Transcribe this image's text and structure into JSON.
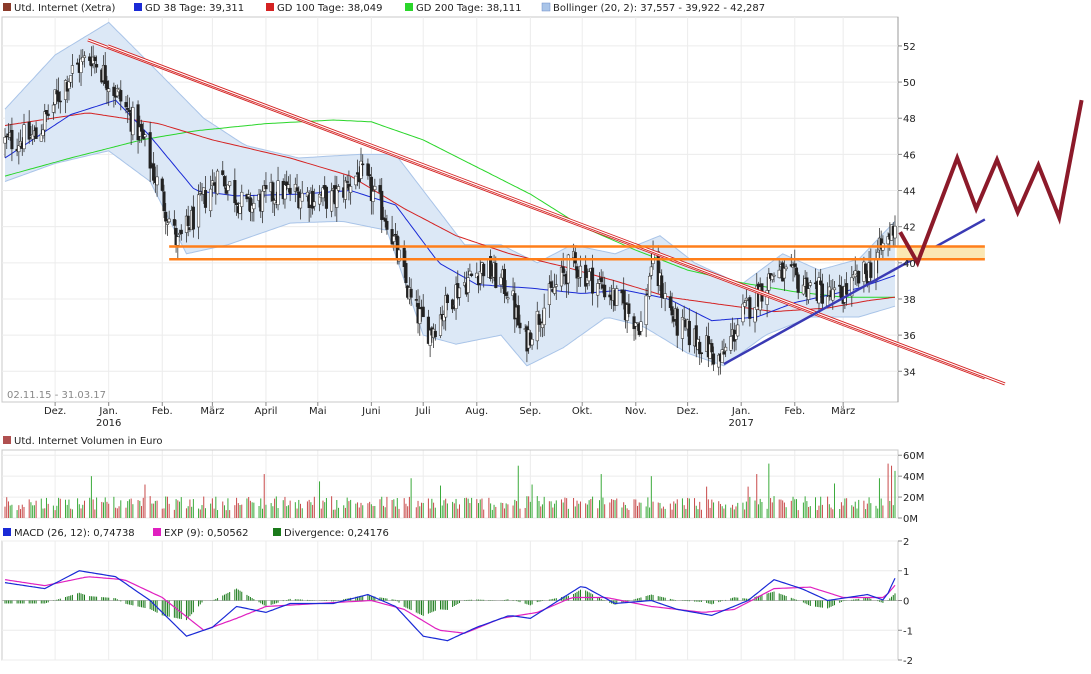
{
  "price_panel": {
    "legend": [
      {
        "label": "Utd. Internet (Xetra)",
        "color": "#8a3a2a"
      },
      {
        "label": "GD 38 Tage: 39,311",
        "color": "#1a2ad6"
      },
      {
        "label": "GD 100 Tage: 38,049",
        "color": "#d42222"
      },
      {
        "label": "GD 200 Tage: 38,111",
        "color": "#2ad62a"
      },
      {
        "label": "Bollinger (20, 2): 37,557 - 39,922 - 42,287",
        "color": "#a9c4e8"
      }
    ],
    "date_range": "02.11.15 - 31.03.17"
  },
  "volume_panel": {
    "legend": [
      {
        "label": "Utd. Internet Volumen in Euro",
        "color": "#b05050"
      }
    ]
  },
  "macd_panel": {
    "legend": [
      {
        "label": "MACD (26, 12): 0,74738",
        "color": "#1a2ad6"
      },
      {
        "label": "EXP (9): 0,50562",
        "color": "#e020c0"
      },
      {
        "label": "Divergence: 0,24176",
        "color": "#1a7a1a"
      }
    ]
  },
  "chart_data": [
    {
      "type": "candlestick",
      "x_tick_labels": [
        "Dez.",
        "Jan.",
        "Feb.",
        "März",
        "April",
        "Mai",
        "Juni",
        "Juli",
        "Aug.",
        "Sep.",
        "Okt.",
        "Nov.",
        "Dez.",
        "Jan.",
        "Feb.",
        "März"
      ],
      "x_year_labels": [
        {
          "label": "2016",
          "under": "Jan."
        },
        {
          "label": "2017",
          "under": "Jan."
        }
      ],
      "y_tick_labels": [
        "52",
        "50",
        "48",
        "46",
        "44",
        "42",
        "40",
        "38",
        "36",
        "34"
      ],
      "ylim": [
        32.3,
        53.6
      ],
      "close_keypoints": [
        [
          "2015-11-02",
          46.7
        ],
        [
          "2015-11-20",
          47.0
        ],
        [
          "2015-12-10",
          50.5
        ],
        [
          "2015-12-22",
          51.5
        ],
        [
          "2016-01-05",
          49.5
        ],
        [
          "2016-01-20",
          47.0
        ],
        [
          "2016-02-10",
          41.0
        ],
        [
          "2016-02-25",
          43.5
        ],
        [
          "2016-03-05",
          45.0
        ],
        [
          "2016-03-20",
          43.0
        ],
        [
          "2016-04-10",
          44.0
        ],
        [
          "2016-05-10",
          43.5
        ],
        [
          "2016-05-25",
          45.0
        ],
        [
          "2016-06-10",
          42.5
        ],
        [
          "2016-06-25",
          37.5
        ],
        [
          "2016-07-05",
          36.2
        ],
        [
          "2016-07-20",
          38.5
        ],
        [
          "2016-08-05",
          39.8
        ],
        [
          "2016-08-20",
          38.5
        ],
        [
          "2016-08-28",
          35.5
        ],
        [
          "2016-09-10",
          37.8
        ],
        [
          "2016-09-25",
          40.0
        ],
        [
          "2016-10-15",
          38.5
        ],
        [
          "2016-11-05",
          36.5
        ],
        [
          "2016-11-10",
          40.0
        ],
        [
          "2016-11-25",
          36.5
        ],
        [
          "2016-12-10",
          35.5
        ],
        [
          "2016-12-20",
          34.5
        ],
        [
          "2017-01-01",
          37.0
        ],
        [
          "2017-01-20",
          39.5
        ],
        [
          "2017-02-10",
          38.7
        ],
        [
          "2017-02-25",
          38.0
        ],
        [
          "2017-03-15",
          39.5
        ],
        [
          "2017-03-28",
          41.5
        ],
        [
          "2017-03-31",
          42.3
        ]
      ],
      "gd38_keypoints": [
        [
          "2015-11-02",
          45.8
        ],
        [
          "2015-12-10",
          48.2
        ],
        [
          "2016-01-05",
          49.0
        ],
        [
          "2016-01-25",
          47.0
        ],
        [
          "2016-02-20",
          44.0
        ],
        [
          "2016-03-15",
          43.7
        ],
        [
          "2016-04-20",
          43.8
        ],
        [
          "2016-05-20",
          44.0
        ],
        [
          "2016-06-15",
          43.2
        ],
        [
          "2016-07-10",
          40.0
        ],
        [
          "2016-08-01",
          38.8
        ],
        [
          "2016-09-01",
          38.6
        ],
        [
          "2016-10-01",
          38.3
        ],
        [
          "2016-10-25",
          38.5
        ],
        [
          "2016-11-20",
          38.0
        ],
        [
          "2016-12-15",
          36.8
        ],
        [
          "2017-01-10",
          37.0
        ],
        [
          "2017-02-01",
          37.8
        ],
        [
          "2017-02-20",
          38.2
        ],
        [
          "2017-03-10",
          38.6
        ],
        [
          "2017-03-31",
          39.3
        ]
      ],
      "gd100_keypoints": [
        [
          "2015-11-02",
          47.6
        ],
        [
          "2015-12-20",
          48.3
        ],
        [
          "2016-01-30",
          47.7
        ],
        [
          "2016-03-01",
          46.8
        ],
        [
          "2016-04-15",
          45.8
        ],
        [
          "2016-05-20",
          44.8
        ],
        [
          "2016-06-20",
          43.0
        ],
        [
          "2016-07-20",
          41.5
        ],
        [
          "2016-08-20",
          40.5
        ],
        [
          "2016-09-20",
          39.8
        ],
        [
          "2016-10-20",
          39.0
        ],
        [
          "2016-11-20",
          38.1
        ],
        [
          "2016-12-20",
          37.7
        ],
        [
          "2017-01-20",
          37.3
        ],
        [
          "2017-02-20",
          37.5
        ],
        [
          "2017-03-15",
          37.9
        ],
        [
          "2017-03-31",
          38.1
        ]
      ],
      "gd200_keypoints": [
        [
          "2015-11-02",
          44.8
        ],
        [
          "2015-12-10",
          45.8
        ],
        [
          "2016-01-20",
          46.8
        ],
        [
          "2016-02-20",
          47.3
        ],
        [
          "2016-04-01",
          47.7
        ],
        [
          "2016-05-10",
          47.9
        ],
        [
          "2016-06-01",
          47.8
        ],
        [
          "2016-07-01",
          46.8
        ],
        [
          "2016-08-01",
          45.3
        ],
        [
          "2016-09-01",
          43.8
        ],
        [
          "2016-10-01",
          42.0
        ],
        [
          "2016-11-01",
          40.7
        ],
        [
          "2016-12-01",
          39.6
        ],
        [
          "2017-01-01",
          38.9
        ],
        [
          "2017-02-01",
          38.4
        ],
        [
          "2017-03-01",
          38.1
        ],
        [
          "2017-03-31",
          38.1
        ]
      ],
      "bollinger_upper_keypoints": [
        [
          "2015-11-02",
          48.5
        ],
        [
          "2015-12-01",
          51.5
        ],
        [
          "2016-01-01",
          53.3
        ],
        [
          "2016-01-25",
          51.0
        ],
        [
          "2016-02-25",
          48.0
        ],
        [
          "2016-03-20",
          46.5
        ],
        [
          "2016-04-20",
          45.8
        ],
        [
          "2016-05-25",
          46.0
        ],
        [
          "2016-06-15",
          46.0
        ],
        [
          "2016-07-05",
          43.5
        ],
        [
          "2016-07-25",
          41.0
        ],
        [
          "2016-08-15",
          41.0
        ],
        [
          "2016-09-05",
          40.0
        ],
        [
          "2016-09-25",
          41.0
        ],
        [
          "2016-10-20",
          40.5
        ],
        [
          "2016-11-15",
          41.5
        ],
        [
          "2016-12-05",
          40.0
        ],
        [
          "2017-01-01",
          38.8
        ],
        [
          "2017-01-25",
          40.5
        ],
        [
          "2017-02-15",
          39.6
        ],
        [
          "2017-03-10",
          40.2
        ],
        [
          "2017-03-31",
          42.3
        ]
      ],
      "bollinger_lower_keypoints": [
        [
          "2015-11-02",
          44.5
        ],
        [
          "2015-12-01",
          45.5
        ],
        [
          "2016-01-01",
          46.2
        ],
        [
          "2016-01-25",
          44.5
        ],
        [
          "2016-02-15",
          40.5
        ],
        [
          "2016-03-10",
          41.0
        ],
        [
          "2016-04-15",
          42.2
        ],
        [
          "2016-05-15",
          42.3
        ],
        [
          "2016-06-10",
          41.8
        ],
        [
          "2016-07-01",
          36.0
        ],
        [
          "2016-07-20",
          35.5
        ],
        [
          "2016-08-15",
          36.0
        ],
        [
          "2016-08-30",
          34.3
        ],
        [
          "2016-09-20",
          35.3
        ],
        [
          "2016-10-15",
          37.0
        ],
        [
          "2016-11-05",
          36.5
        ],
        [
          "2016-12-01",
          35.0
        ],
        [
          "2016-12-22",
          34.3
        ],
        [
          "2017-01-15",
          36.0
        ],
        [
          "2017-02-10",
          37.0
        ],
        [
          "2017-03-10",
          37.0
        ],
        [
          "2017-03-31",
          37.6
        ]
      ],
      "drawn_lines": [
        {
          "kind": "downtrend-channel",
          "color": "#d42222",
          "from": [
            "2015-12-20",
            52.0
          ],
          "to": [
            "2017-05-22",
            33.3
          ]
        },
        {
          "kind": "uptrend",
          "color": "#3a3ab4",
          "from": [
            "2016-12-22",
            34.4
          ],
          "to": [
            "2017-05-22",
            42.4
          ]
        },
        {
          "kind": "support-band",
          "color": "#ff7f1a",
          "values": [
            40.2,
            40.9
          ],
          "from": "2016-02-05",
          "to": "2017-05-22"
        },
        {
          "kind": "forecast-zigzag",
          "color": "#8c1a2a",
          "points": [
            [
              "2017-04-03",
              41.7
            ],
            [
              "2017-04-13",
              40.0
            ],
            [
              "2017-05-06",
              45.8
            ],
            [
              "2017-05-17",
              43.0
            ],
            [
              "2017-05-29",
              45.7
            ],
            [
              "2017-06-10",
              42.8
            ],
            [
              "2017-06-22",
              45.4
            ],
            [
              "2017-07-04",
              42.5
            ],
            [
              "2017-07-17",
              49.0
            ]
          ]
        }
      ]
    },
    {
      "type": "bar",
      "title": "Utd. Internet Volumen in Euro",
      "y_tick_labels": [
        "60M",
        "40M",
        "20M",
        "0M"
      ],
      "ylim": [
        0,
        65
      ],
      "unit": "M EUR",
      "typical_volume": 15,
      "spikes": [
        [
          "2015-12-22",
          40
        ],
        [
          "2016-01-22",
          32
        ],
        [
          "2016-03-31",
          42
        ],
        [
          "2016-05-02",
          35
        ],
        [
          "2016-06-24",
          38
        ],
        [
          "2016-07-11",
          31
        ],
        [
          "2016-08-25",
          50
        ],
        [
          "2016-09-02",
          32
        ],
        [
          "2016-10-12",
          42
        ],
        [
          "2016-11-10",
          40
        ],
        [
          "2016-12-12",
          30
        ],
        [
          "2017-01-05",
          30
        ],
        [
          "2017-01-10",
          42
        ],
        [
          "2017-01-17",
          52
        ],
        [
          "2017-02-24",
          33
        ],
        [
          "2017-03-22",
          38
        ],
        [
          "2017-03-27",
          52
        ],
        [
          "2017-03-29",
          50
        ],
        [
          "2017-03-31",
          45
        ]
      ]
    },
    {
      "type": "line",
      "y_tick_labels": [
        "2",
        "1",
        "0",
        "-1",
        "-2"
      ],
      "ylim": [
        -2.0,
        2.0
      ],
      "series": [
        {
          "name": "MACD (26, 12)",
          "color": "#1a2ad6",
          "keypoints": [
            [
              "2015-11-02",
              0.6
            ],
            [
              "2015-11-25",
              0.4
            ],
            [
              "2015-12-15",
              1.0
            ],
            [
              "2016-01-05",
              0.8
            ],
            [
              "2016-01-25",
              0.0
            ],
            [
              "2016-02-15",
              -1.2
            ],
            [
              "2016-03-01",
              -0.9
            ],
            [
              "2016-03-15",
              -0.2
            ],
            [
              "2016-04-01",
              -0.4
            ],
            [
              "2016-04-15",
              -0.1
            ],
            [
              "2016-05-10",
              -0.1
            ],
            [
              "2016-05-30",
              0.2
            ],
            [
              "2016-06-15",
              -0.2
            ],
            [
              "2016-07-01",
              -1.2
            ],
            [
              "2016-07-15",
              -1.35
            ],
            [
              "2016-08-01",
              -0.9
            ],
            [
              "2016-08-20",
              -0.5
            ],
            [
              "2016-09-01",
              -0.6
            ],
            [
              "2016-09-20",
              0.1
            ],
            [
              "2016-10-01",
              0.5
            ],
            [
              "2016-10-20",
              -0.1
            ],
            [
              "2016-11-10",
              0.0
            ],
            [
              "2016-11-25",
              -0.3
            ],
            [
              "2016-12-15",
              -0.5
            ],
            [
              "2017-01-05",
              0.0
            ],
            [
              "2017-01-20",
              0.7
            ],
            [
              "2017-02-05",
              0.4
            ],
            [
              "2017-02-20",
              0.0
            ],
            [
              "2017-03-15",
              0.2
            ],
            [
              "2017-03-25",
              0.0
            ],
            [
              "2017-03-31",
              0.75
            ]
          ]
        },
        {
          "name": "EXP (9)",
          "color": "#e020c0",
          "keypoints": [
            [
              "2015-11-02",
              0.7
            ],
            [
              "2015-11-25",
              0.5
            ],
            [
              "2015-12-20",
              0.8
            ],
            [
              "2016-01-10",
              0.7
            ],
            [
              "2016-02-01",
              0.1
            ],
            [
              "2016-02-25",
              -1.0
            ],
            [
              "2016-03-15",
              -0.6
            ],
            [
              "2016-04-01",
              -0.2
            ],
            [
              "2016-05-01",
              -0.1
            ],
            [
              "2016-06-01",
              0.0
            ],
            [
              "2016-06-20",
              -0.3
            ],
            [
              "2016-07-10",
              -1.0
            ],
            [
              "2016-07-25",
              -1.1
            ],
            [
              "2016-08-15",
              -0.6
            ],
            [
              "2016-09-05",
              -0.4
            ],
            [
              "2016-09-25",
              0.1
            ],
            [
              "2016-10-15",
              0.1
            ],
            [
              "2016-11-10",
              -0.2
            ],
            [
              "2016-12-10",
              -0.4
            ],
            [
              "2016-12-28",
              -0.3
            ],
            [
              "2017-01-20",
              0.4
            ],
            [
              "2017-02-10",
              0.45
            ],
            [
              "2017-03-01",
              0.1
            ],
            [
              "2017-03-25",
              0.1
            ],
            [
              "2017-03-31",
              0.51
            ]
          ]
        }
      ]
    }
  ]
}
